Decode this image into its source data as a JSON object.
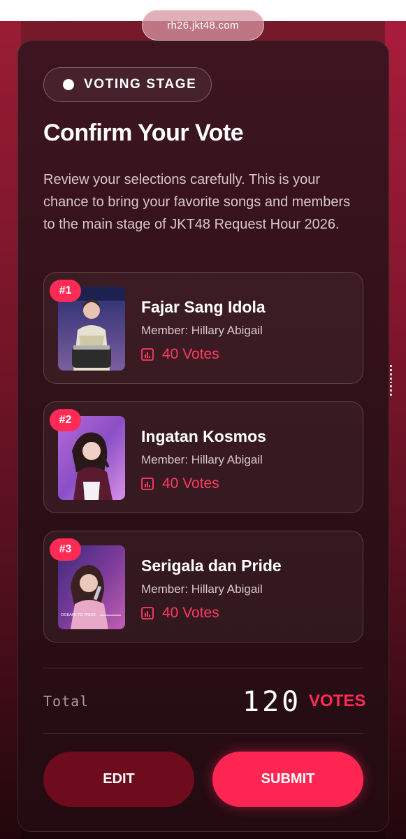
{
  "browser": {
    "url": "rh26.jkt48.com"
  },
  "page": {
    "stage_badge": "VOTING STAGE",
    "title": "Confirm Your Vote",
    "description": "Review your selections carefully. This is your chance to bring your favorite songs and members to the main stage of JKT48 Request Hour 2026."
  },
  "votes": [
    {
      "rank": "#1",
      "song": "Fajar Sang Idola",
      "member": "Member: Hillary Abigail",
      "votes": "40 Votes"
    },
    {
      "rank": "#2",
      "song": "Ingatan Kosmos",
      "member": "Member: Hillary Abigail",
      "votes": "40 Votes"
    },
    {
      "rank": "#3",
      "song": "Serigala dan Pride",
      "member": "Member: Hillary Abigail",
      "votes": "40 Votes",
      "thumb_caption": "OOKAMI TO PRIDE"
    }
  ],
  "total": {
    "label": "Total",
    "value": "120",
    "unit": "VOTES"
  },
  "actions": {
    "edit_label": "EDIT",
    "submit_label": "SUBMIT"
  },
  "colors": {
    "accent": "#ff2b55",
    "edit_button": "#6e0b1c",
    "card_background": "#2f1018"
  },
  "icons": {
    "status": "dot-icon",
    "votes": "bar-chart-icon"
  }
}
